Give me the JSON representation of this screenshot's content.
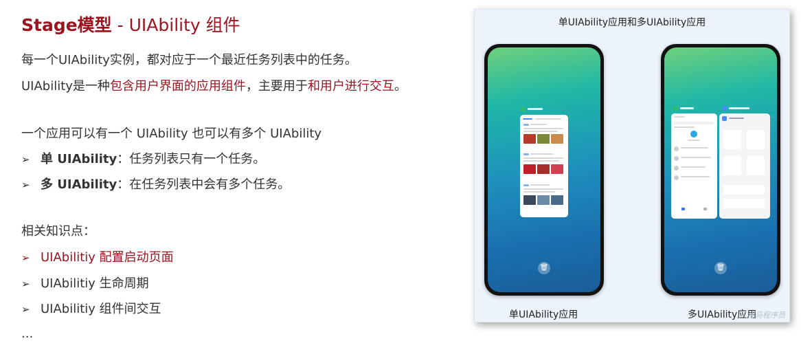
{
  "title": {
    "bold": "Stage模型",
    "rest": " - UIAbility 组件"
  },
  "intro": {
    "line1": "每一个UIAbility实例，都对应于一个最近任务列表中的任务。",
    "line2": {
      "p1": "UIAbility是一种",
      "h1": "包含用户界面的应用组件",
      "p2": "，主要用于",
      "h2": "和用户进行交互",
      "p3": "。"
    }
  },
  "section": {
    "heading": "一个应用可以有一个 UIAbility 也可以有多个 UIAbility",
    "items": [
      {
        "arrow": "➢",
        "bold": "单 UIAbility",
        "text": "：任务列表只有一个任务。"
      },
      {
        "arrow": "➢",
        "bold": "多 UIAbility",
        "text": "：在任务列表中会有多个任务。"
      }
    ]
  },
  "related": {
    "heading": "相关知识点：",
    "items": [
      {
        "arrow": "➢",
        "text": "UIAbilitiy 配置启动页面",
        "highlight": true
      },
      {
        "arrow": "➢",
        "text": "UIAbilitiy 生命周期",
        "highlight": false
      },
      {
        "arrow": "➢",
        "text": "UIAbilitiy 组件间交互",
        "highlight": false
      }
    ],
    "ellipsis": "..."
  },
  "figure": {
    "title": "单UIAbility应用和多UIAbility应用",
    "caption_single": "单UIAbility应用",
    "caption_multi": "多UIAbility应用",
    "watermark": "黑马程序员",
    "trash_icon": "🗑"
  },
  "colors": {
    "accent": "#9b1420",
    "panel": "#ecf3fa",
    "text": "#333333"
  }
}
